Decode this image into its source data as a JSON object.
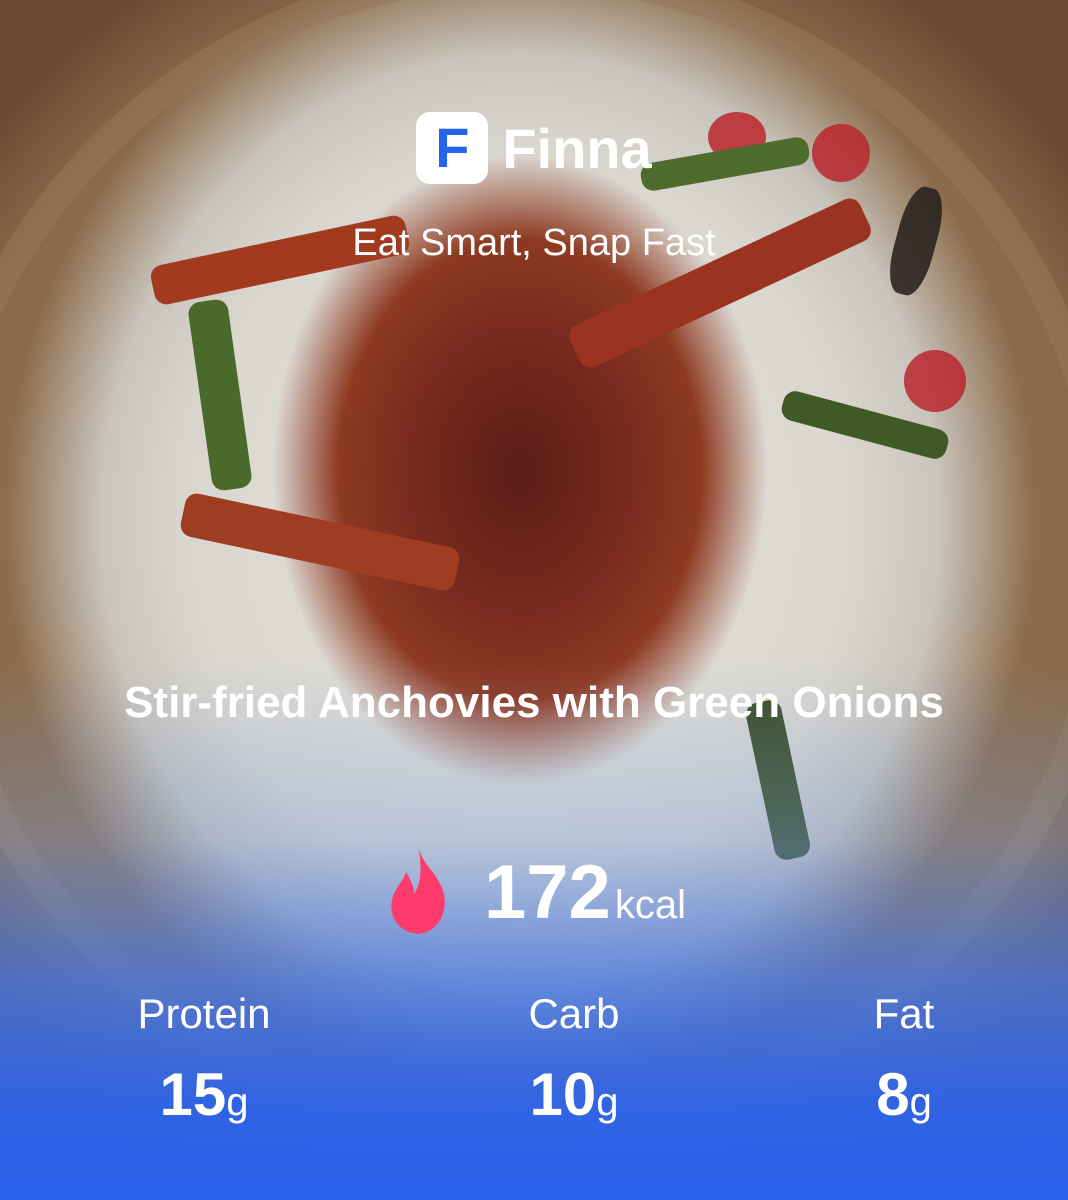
{
  "app": {
    "name": "Finna",
    "logo_letter": "F",
    "tagline": "Eat Smart, Snap Fast"
  },
  "meal": {
    "name": "Stir-fried Anchovies with Green Onions",
    "calories": "172",
    "calories_unit": "kcal",
    "calorie_icon": "fire-icon"
  },
  "macros": {
    "protein": {
      "label": "Protein",
      "value": "15",
      "unit": "g"
    },
    "carb": {
      "label": "Carb",
      "value": "10",
      "unit": "g"
    },
    "fat": {
      "label": "Fat",
      "value": "8",
      "unit": "g"
    }
  },
  "colors": {
    "brand_blue": "#2563eb",
    "fire_red": "#ff3b6b",
    "text": "#ffffff"
  }
}
